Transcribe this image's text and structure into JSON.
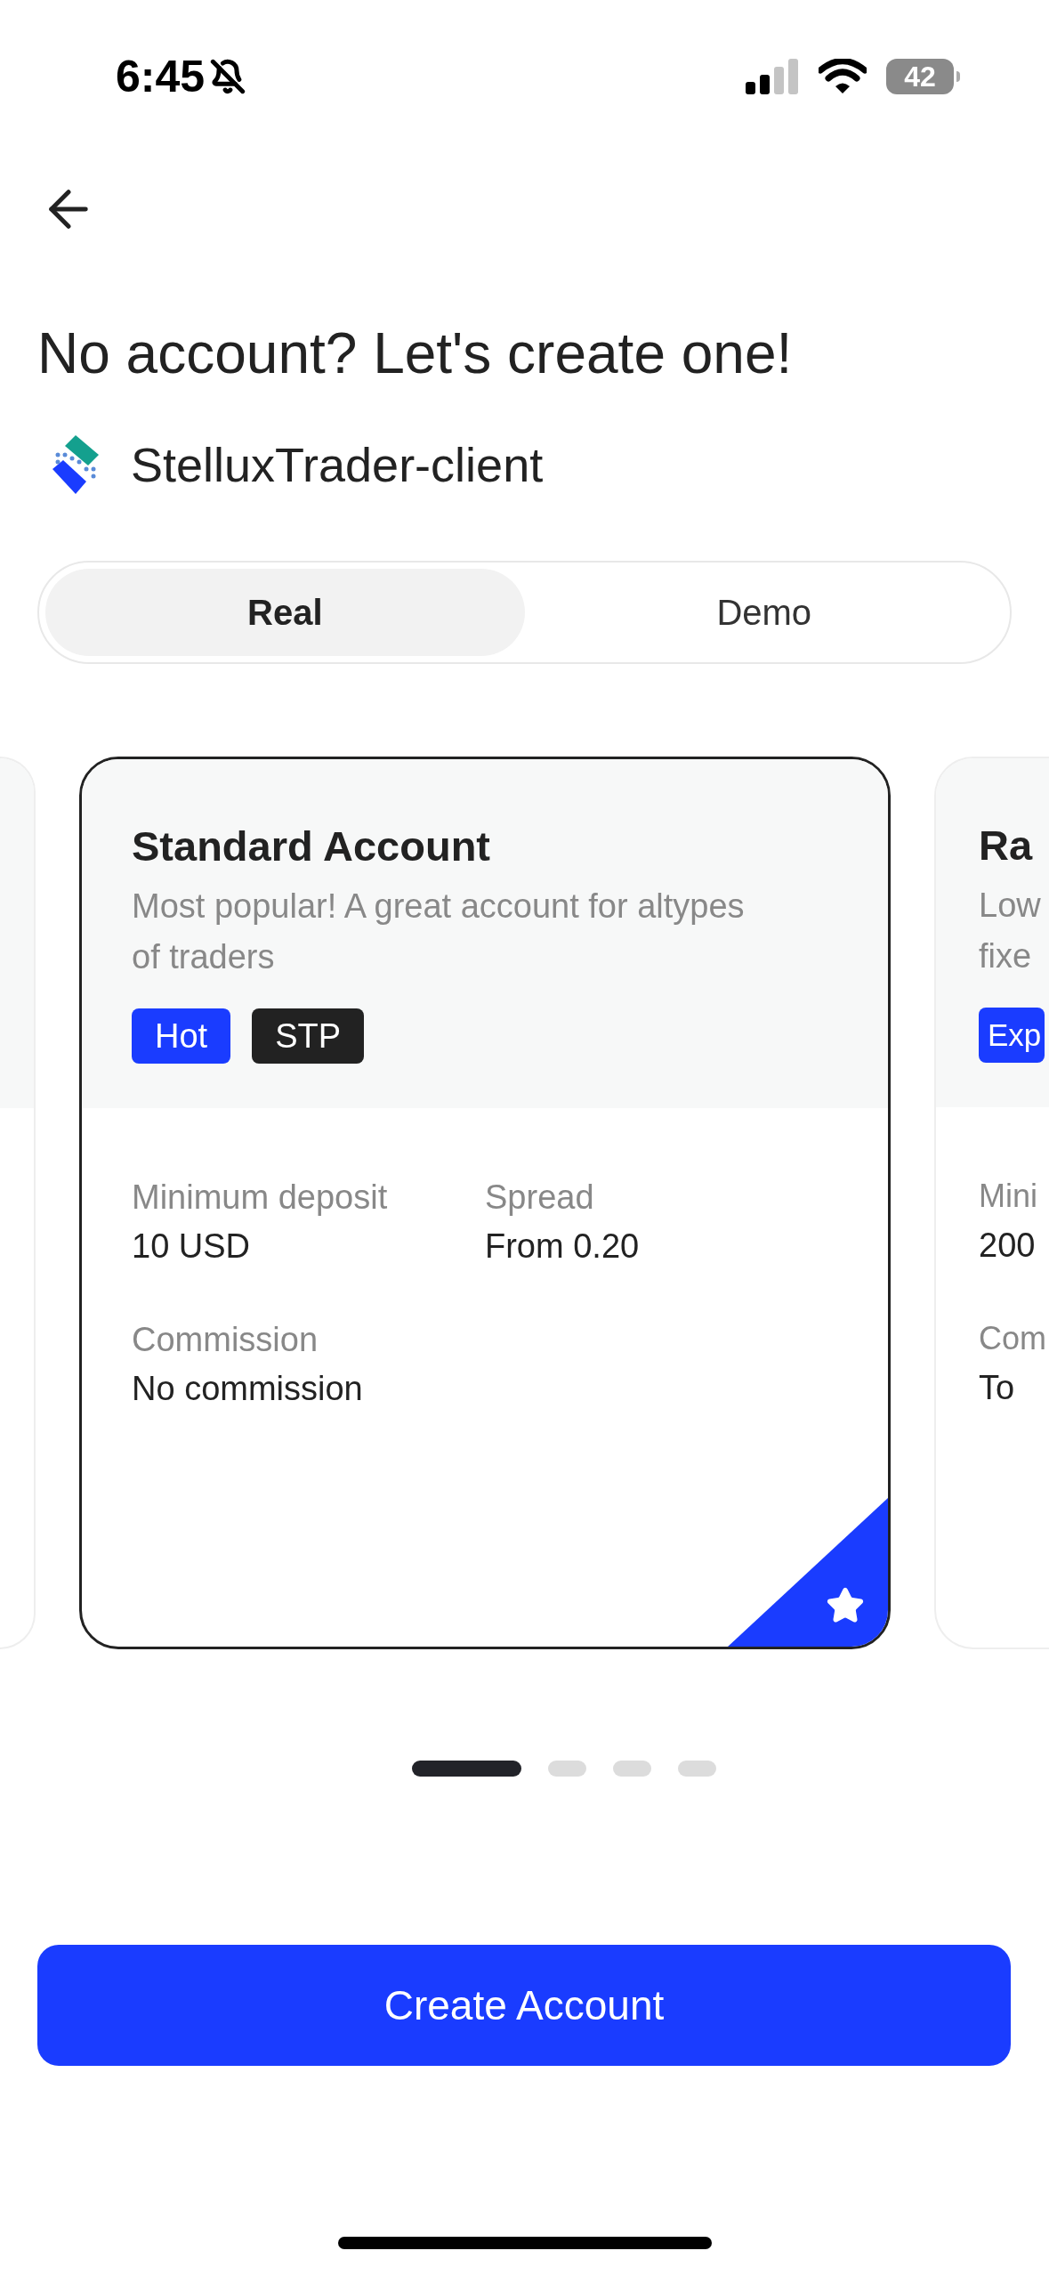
{
  "status_bar": {
    "time": "6:45",
    "battery": "42"
  },
  "title": "No account? Let's create one!",
  "brand": {
    "name": "StelluxTrader-client"
  },
  "tabs": [
    {
      "label": "Real",
      "selected": true
    },
    {
      "label": "Demo",
      "selected": false
    }
  ],
  "cards": [
    {
      "title": "Standard Account",
      "description": [
        "Most popular! A great account for altypes",
        "of traders"
      ],
      "tags": [
        {
          "label": "Hot",
          "color": "#1a3cff"
        },
        {
          "label": "STP",
          "color": "#222222"
        }
      ],
      "fields": [
        {
          "label": "Minimum deposit",
          "value": "10 USD"
        },
        {
          "label": "Spread",
          "value": "From 0.20"
        },
        {
          "label": "Commission",
          "value": "No commission"
        }
      ],
      "featured": true
    },
    {
      "title": "Ra",
      "description": [
        "Low",
        "fixe"
      ],
      "tags": [
        {
          "label": "Exp",
          "color": "#1a3cff"
        }
      ],
      "fields": [
        {
          "label": "Mini",
          "value": "200"
        },
        {
          "label": "Com",
          "value": "To"
        }
      ],
      "featured": false
    }
  ],
  "pager": [
    {
      "selected": true
    },
    {
      "selected": false
    },
    {
      "selected": false
    },
    {
      "selected": false
    }
  ],
  "button": "Create Account"
}
